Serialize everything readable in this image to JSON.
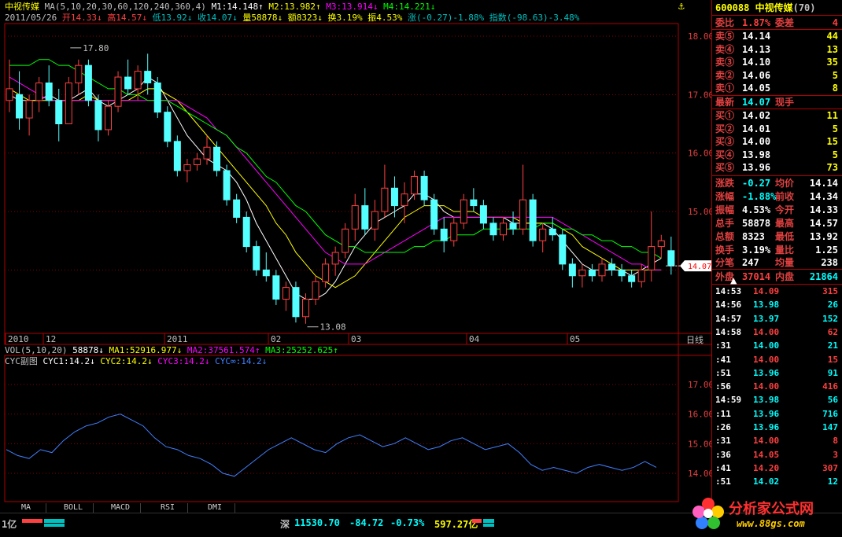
{
  "header": {
    "stock_name": "中视传媒",
    "ma_label": "MA(5,10,20,30,60,120,240,360,4)",
    "m1": "M1:14.148↑",
    "m2": "M2:13.982↑",
    "m3": "M3:13.914↓",
    "m4": "M4:14.221↓",
    "date": "2011/05/26",
    "open": "开14.33↓",
    "high": "高14.57↓",
    "low": "低13.92↓",
    "close": "收14.07↓",
    "volume": "量58878↓",
    "amount": "额8323↓",
    "turnover": "换3.19%",
    "amplitude": "振4.53%",
    "change": "涨(-0.27)-1.88%",
    "index": "指数(-98.63)-3.48%"
  },
  "vol_header": {
    "label": "VOL(5,10,20)",
    "v": "58878↓",
    "ma1": "MA1:52916.977↓",
    "ma2": "MA2:37561.574↑",
    "ma3": "MA3:25252.625↑"
  },
  "cyc_header": {
    "label": "CYC副图",
    "c1": "CYC1:14.2↓",
    "c2": "CYC2:14.2↓",
    "c3": "CYC3:14.2↓",
    "cinf": "CYC∞:14.2↓"
  },
  "chart_data": {
    "type": "candlestick",
    "price_axis": [
      "18.00",
      "17.00",
      "16.00",
      "15.00"
    ],
    "price_range": [
      13.08,
      18.0
    ],
    "cyc_axis": [
      "17.00",
      "16.00",
      "15.00",
      "14.00"
    ],
    "current_price_tag": "14.07",
    "peak_label": "17.80",
    "low_label": "13.08",
    "date_axis": [
      "2010",
      "12",
      "2011",
      "02",
      "03",
      "04",
      "05"
    ],
    "period_label": "日线",
    "cyc_series": [
      14.8,
      14.6,
      14.5,
      14.8,
      14.7,
      15.1,
      15.4,
      15.6,
      15.7,
      15.9,
      16.0,
      15.8,
      15.6,
      15.2,
      14.9,
      14.8,
      14.6,
      14.5,
      14.3,
      14.0,
      13.9,
      14.2,
      14.5,
      14.8,
      15.0,
      15.2,
      15.0,
      14.8,
      14.7,
      15.0,
      15.2,
      15.3,
      15.1,
      14.9,
      15.0,
      15.2,
      15.0,
      14.8,
      14.9,
      15.1,
      15.2,
      15.0,
      14.8,
      14.9,
      15.0,
      14.7,
      14.3,
      14.1,
      14.2,
      14.1,
      14.0,
      14.2,
      14.3,
      14.2,
      14.1,
      14.2,
      14.4,
      14.2
    ],
    "candles": [
      {
        "o": 16.9,
        "h": 17.6,
        "l": 16.7,
        "c": 17.1
      },
      {
        "o": 17.0,
        "h": 17.4,
        "l": 16.4,
        "c": 16.6
      },
      {
        "o": 16.6,
        "h": 17.0,
        "l": 16.3,
        "c": 16.9
      },
      {
        "o": 16.9,
        "h": 17.3,
        "l": 16.7,
        "c": 17.2
      },
      {
        "o": 17.2,
        "h": 17.5,
        "l": 16.8,
        "c": 16.9
      },
      {
        "o": 16.9,
        "h": 17.1,
        "l": 16.2,
        "c": 16.5
      },
      {
        "o": 16.5,
        "h": 17.3,
        "l": 16.5,
        "c": 17.2
      },
      {
        "o": 17.2,
        "h": 17.6,
        "l": 17.0,
        "c": 17.5
      },
      {
        "o": 17.5,
        "h": 17.6,
        "l": 16.8,
        "c": 16.9
      },
      {
        "o": 16.9,
        "h": 17.0,
        "l": 16.2,
        "c": 16.4
      },
      {
        "o": 16.4,
        "h": 16.9,
        "l": 16.3,
        "c": 16.8
      },
      {
        "o": 16.8,
        "h": 17.4,
        "l": 16.7,
        "c": 17.3
      },
      {
        "o": 17.3,
        "h": 17.6,
        "l": 17.0,
        "c": 17.1
      },
      {
        "o": 17.1,
        "h": 17.5,
        "l": 16.9,
        "c": 17.4
      },
      {
        "o": 17.4,
        "h": 17.7,
        "l": 17.0,
        "c": 17.2
      },
      {
        "o": 17.2,
        "h": 17.3,
        "l": 16.6,
        "c": 16.7
      },
      {
        "o": 16.7,
        "h": 16.8,
        "l": 16.1,
        "c": 16.2
      },
      {
        "o": 16.2,
        "h": 16.3,
        "l": 15.6,
        "c": 15.7
      },
      {
        "o": 15.7,
        "h": 15.9,
        "l": 15.5,
        "c": 15.8
      },
      {
        "o": 15.8,
        "h": 16.0,
        "l": 15.7,
        "c": 15.9
      },
      {
        "o": 15.9,
        "h": 16.3,
        "l": 15.8,
        "c": 16.1
      },
      {
        "o": 16.1,
        "h": 16.2,
        "l": 15.6,
        "c": 15.7
      },
      {
        "o": 15.7,
        "h": 15.8,
        "l": 15.1,
        "c": 15.2
      },
      {
        "o": 15.2,
        "h": 15.3,
        "l": 14.8,
        "c": 14.9
      },
      {
        "o": 14.9,
        "h": 15.0,
        "l": 14.3,
        "c": 14.4
      },
      {
        "o": 14.4,
        "h": 14.5,
        "l": 13.9,
        "c": 14.0
      },
      {
        "o": 14.0,
        "h": 14.3,
        "l": 13.8,
        "c": 13.9
      },
      {
        "o": 13.9,
        "h": 14.0,
        "l": 13.4,
        "c": 13.5
      },
      {
        "o": 13.5,
        "h": 13.8,
        "l": 13.3,
        "c": 13.7
      },
      {
        "o": 13.7,
        "h": 13.8,
        "l": 13.1,
        "c": 13.2
      },
      {
        "o": 13.2,
        "h": 13.6,
        "l": 13.08,
        "c": 13.5
      },
      {
        "o": 13.5,
        "h": 13.9,
        "l": 13.4,
        "c": 13.8
      },
      {
        "o": 13.8,
        "h": 14.2,
        "l": 13.7,
        "c": 14.1
      },
      {
        "o": 14.1,
        "h": 14.4,
        "l": 13.9,
        "c": 14.3
      },
      {
        "o": 14.3,
        "h": 14.8,
        "l": 14.2,
        "c": 14.7
      },
      {
        "o": 14.7,
        "h": 15.3,
        "l": 14.5,
        "c": 15.1
      },
      {
        "o": 15.1,
        "h": 15.4,
        "l": 14.6,
        "c": 14.7
      },
      {
        "o": 14.7,
        "h": 15.2,
        "l": 14.5,
        "c": 15.0
      },
      {
        "o": 15.0,
        "h": 15.8,
        "l": 14.9,
        "c": 15.4
      },
      {
        "o": 15.4,
        "h": 15.6,
        "l": 14.9,
        "c": 15.1
      },
      {
        "o": 15.1,
        "h": 15.5,
        "l": 14.8,
        "c": 15.3
      },
      {
        "o": 15.3,
        "h": 15.7,
        "l": 15.2,
        "c": 15.6
      },
      {
        "o": 15.6,
        "h": 15.7,
        "l": 15.1,
        "c": 15.2
      },
      {
        "o": 15.2,
        "h": 15.3,
        "l": 14.6,
        "c": 14.7
      },
      {
        "o": 14.7,
        "h": 14.9,
        "l": 14.3,
        "c": 14.5
      },
      {
        "o": 14.5,
        "h": 14.9,
        "l": 14.4,
        "c": 14.8
      },
      {
        "o": 14.8,
        "h": 15.3,
        "l": 14.7,
        "c": 15.2
      },
      {
        "o": 15.2,
        "h": 15.4,
        "l": 15.0,
        "c": 15.1
      },
      {
        "o": 15.1,
        "h": 15.2,
        "l": 14.7,
        "c": 14.8
      },
      {
        "o": 14.8,
        "h": 14.9,
        "l": 14.5,
        "c": 14.6
      },
      {
        "o": 14.6,
        "h": 14.9,
        "l": 14.5,
        "c": 14.8
      },
      {
        "o": 14.8,
        "h": 15.0,
        "l": 14.6,
        "c": 14.7
      },
      {
        "o": 14.7,
        "h": 15.8,
        "l": 14.6,
        "c": 15.2
      },
      {
        "o": 15.2,
        "h": 15.3,
        "l": 14.4,
        "c": 14.5
      },
      {
        "o": 14.5,
        "h": 14.8,
        "l": 14.3,
        "c": 14.7
      },
      {
        "o": 14.7,
        "h": 14.9,
        "l": 14.5,
        "c": 14.6
      },
      {
        "o": 14.6,
        "h": 14.7,
        "l": 14.0,
        "c": 14.1
      },
      {
        "o": 14.1,
        "h": 14.2,
        "l": 13.7,
        "c": 13.9
      },
      {
        "o": 13.9,
        "h": 14.1,
        "l": 13.7,
        "c": 14.0
      },
      {
        "o": 14.0,
        "h": 14.1,
        "l": 13.8,
        "c": 13.9
      },
      {
        "o": 13.9,
        "h": 14.2,
        "l": 13.8,
        "c": 14.1
      },
      {
        "o": 14.1,
        "h": 14.2,
        "l": 13.9,
        "c": 14.0
      },
      {
        "o": 14.0,
        "h": 14.1,
        "l": 13.8,
        "c": 13.9
      },
      {
        "o": 13.9,
        "h": 14.0,
        "l": 13.7,
        "c": 13.8
      },
      {
        "o": 13.8,
        "h": 14.1,
        "l": 13.7,
        "c": 14.0
      },
      {
        "o": 14.0,
        "h": 15.0,
        "l": 13.8,
        "c": 14.4
      },
      {
        "o": 14.4,
        "h": 14.6,
        "l": 14.2,
        "c": 14.5
      },
      {
        "o": 14.33,
        "h": 14.57,
        "l": 13.92,
        "c": 14.07
      }
    ],
    "ma_lines": [
      {
        "name": "MA5",
        "color": "#ffffff",
        "values": [
          17.0,
          16.9,
          16.9,
          16.9,
          17.0,
          16.9,
          16.9,
          17.0,
          17.1,
          16.9,
          16.8,
          16.9,
          17.0,
          17.1,
          17.3,
          17.2,
          16.9,
          16.6,
          16.3,
          16.1,
          15.9,
          15.8,
          15.7,
          15.5,
          15.2,
          14.8,
          14.5,
          14.2,
          13.9,
          13.6,
          13.5,
          13.5,
          13.6,
          13.8,
          14.1,
          14.4,
          14.6,
          14.8,
          14.9,
          15.0,
          15.1,
          15.3,
          15.3,
          15.2,
          15.0,
          14.9,
          14.9,
          14.9,
          14.9,
          14.9,
          14.9,
          14.8,
          14.8,
          14.8,
          14.8,
          14.7,
          14.5,
          14.3,
          14.1,
          14.0,
          14.0,
          14.0,
          14.0,
          13.9,
          14.0,
          14.1,
          14.2
        ]
      },
      {
        "name": "MA10",
        "color": "#ffff00",
        "values": [
          17.1,
          17.0,
          16.9,
          16.9,
          16.9,
          16.9,
          16.9,
          16.9,
          17.0,
          16.9,
          16.9,
          16.9,
          16.9,
          17.0,
          17.1,
          17.1,
          17.0,
          16.9,
          16.7,
          16.5,
          16.3,
          16.1,
          15.9,
          15.7,
          15.5,
          15.3,
          15.1,
          14.8,
          14.6,
          14.3,
          14.1,
          13.9,
          13.8,
          13.7,
          13.8,
          13.9,
          14.1,
          14.3,
          14.5,
          14.7,
          14.9,
          15.0,
          15.1,
          15.1,
          15.1,
          15.0,
          15.0,
          15.0,
          14.9,
          14.9,
          14.9,
          14.9,
          14.8,
          14.8,
          14.8,
          14.8,
          14.7,
          14.6,
          14.4,
          14.3,
          14.2,
          14.1,
          14.0,
          14.0,
          14.0,
          14.0,
          14.0
        ]
      },
      {
        "name": "MA20",
        "color": "#ff00ff",
        "values": [
          17.3,
          17.2,
          17.1,
          17.0,
          16.9,
          16.9,
          16.9,
          16.9,
          16.9,
          16.9,
          16.9,
          16.9,
          16.9,
          16.9,
          16.9,
          16.9,
          16.9,
          16.9,
          16.8,
          16.7,
          16.6,
          16.4,
          16.3,
          16.1,
          15.9,
          15.7,
          15.5,
          15.3,
          15.1,
          14.9,
          14.7,
          14.5,
          14.3,
          14.2,
          14.1,
          14.1,
          14.1,
          14.2,
          14.3,
          14.4,
          14.5,
          14.6,
          14.7,
          14.8,
          14.9,
          14.9,
          14.9,
          14.9,
          14.9,
          14.9,
          14.9,
          14.9,
          14.9,
          14.9,
          14.9,
          14.9,
          14.8,
          14.7,
          14.6,
          14.5,
          14.4,
          14.3,
          14.2,
          14.1,
          14.1,
          14.0,
          14.0
        ]
      },
      {
        "name": "MA30",
        "color": "#00ff00",
        "values": [
          17.5,
          17.5,
          17.5,
          17.6,
          17.6,
          17.5,
          17.5,
          17.4,
          17.3,
          17.2,
          17.1,
          17.1,
          17.0,
          17.0,
          16.9,
          16.9,
          16.9,
          16.8,
          16.7,
          16.6,
          16.5,
          16.4,
          16.3,
          16.1,
          16.0,
          15.8,
          15.6,
          15.5,
          15.3,
          15.1,
          15.0,
          14.8,
          14.6,
          14.5,
          14.4,
          14.4,
          14.3,
          14.3,
          14.3,
          14.3,
          14.3,
          14.4,
          14.4,
          14.5,
          14.5,
          14.6,
          14.6,
          14.6,
          14.7,
          14.7,
          14.7,
          14.7,
          14.7,
          14.7,
          14.8,
          14.8,
          14.7,
          14.7,
          14.6,
          14.6,
          14.5,
          14.5,
          14.4,
          14.4,
          14.3,
          14.3,
          14.2
        ]
      }
    ]
  },
  "quote_panel": {
    "code": "600088",
    "name": "中视传媒",
    "count": "(70)",
    "ratio_label": "委比",
    "ratio": "1.87%",
    "diff_label": "委差",
    "diff": "4",
    "sells": [
      {
        "label": "卖⑤",
        "price": "14.14",
        "vol": "44"
      },
      {
        "label": "卖④",
        "price": "14.13",
        "vol": "13"
      },
      {
        "label": "卖③",
        "price": "14.10",
        "vol": "35"
      },
      {
        "label": "卖②",
        "price": "14.06",
        "vol": "5"
      },
      {
        "label": "卖①",
        "price": "14.05",
        "vol": "8"
      }
    ],
    "latest_label": "最新",
    "latest": "14.07",
    "hand_label": "现手",
    "buys": [
      {
        "label": "买①",
        "price": "14.02",
        "vol": "11"
      },
      {
        "label": "买②",
        "price": "14.01",
        "vol": "5"
      },
      {
        "label": "买③",
        "price": "14.00",
        "vol": "15"
      },
      {
        "label": "买④",
        "price": "13.98",
        "vol": "5"
      },
      {
        "label": "买⑤",
        "price": "13.96",
        "vol": "73"
      }
    ],
    "stats": [
      {
        "l1": "涨跌",
        "v1": "-0.27",
        "l2": "均价",
        "v2": "14.14"
      },
      {
        "l1": "涨幅",
        "v1": "-1.88%",
        "l2": "前收",
        "v2": "14.34"
      },
      {
        "l1": "振幅",
        "v1": "4.53%",
        "l2": "今开",
        "v2": "14.33"
      },
      {
        "l1": "总手",
        "v1": "58878",
        "l2": "最高",
        "v2": "14.57"
      },
      {
        "l1": "总额",
        "v1": "8323",
        "l2": "最低",
        "v2": "13.92"
      },
      {
        "l1": "换手",
        "v1": "3.19%",
        "l2": "量比",
        "v2": "1.25"
      },
      {
        "l1": "分笔",
        "v1": "247",
        "l2": "均量",
        "v2": "238"
      }
    ],
    "outer_label": "外盘",
    "outer": "37014",
    "inner_label": "内盘",
    "inner": "21864",
    "ticks": [
      {
        "t": "14:53",
        "p": "14.09",
        "v": "315",
        "c": "#ff4040"
      },
      {
        "t": "14:56",
        "p": "13.98",
        "v": "26",
        "c": "#00ffff"
      },
      {
        "t": "14:57",
        "p": "13.97",
        "v": "152",
        "c": "#00ffff"
      },
      {
        "t": "14:58",
        "p": "14.00",
        "v": "62",
        "c": "#ff4040"
      },
      {
        "t": ":31",
        "p": "14.00",
        "v": "21",
        "c": "#00ffff"
      },
      {
        "t": ":41",
        "p": "14.00",
        "v": "15",
        "c": "#ff4040"
      },
      {
        "t": ":51",
        "p": "13.96",
        "v": "91",
        "c": "#00ffff"
      },
      {
        "t": ":56",
        "p": "14.00",
        "v": "416",
        "c": "#ff4040"
      },
      {
        "t": "14:59",
        "p": "13.98",
        "v": "56",
        "c": "#00ffff"
      },
      {
        "t": ":11",
        "p": "13.96",
        "v": "716",
        "c": "#00ffff"
      },
      {
        "t": ":26",
        "p": "13.96",
        "v": "147",
        "c": "#00ffff"
      },
      {
        "t": ":31",
        "p": "14.00",
        "v": "8",
        "c": "#ff4040"
      },
      {
        "t": ":36",
        "p": "14.05",
        "v": "3",
        "c": "#ff4040"
      },
      {
        "t": ":41",
        "p": "14.20",
        "v": "307",
        "c": "#ff4040"
      },
      {
        "t": ":51",
        "p": "14.02",
        "v": "12",
        "c": "#00ffff"
      }
    ]
  },
  "tabs": [
    "MA",
    "BOLL",
    "MACD",
    "RSI",
    "DMI"
  ],
  "status": {
    "left": "1亿",
    "market": "深",
    "index_value": "11530.70",
    "index_change": "-84.72",
    "index_pct": "-0.73%",
    "turnover": "597.27亿"
  },
  "watermark": {
    "title": "分析家公式网",
    "url": "www.88gs.com"
  }
}
